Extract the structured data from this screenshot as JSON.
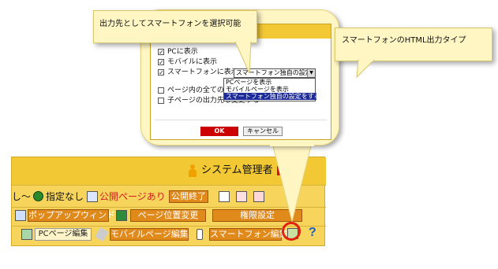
{
  "dialog": {
    "options": [
      {
        "label": "PCに表示",
        "checked": true
      },
      {
        "label": "モバイルに表示",
        "checked": true
      },
      {
        "label": "スマートフォンに表示",
        "checked": true
      },
      {
        "label": "ページ内の全てのエリ",
        "checked": false
      },
      {
        "label": "子ページの出力先も変更する",
        "checked": false
      }
    ],
    "select_value": "スマートフォン独自の設定をする",
    "select_options": [
      "PCページを表示",
      "モバイルページを表示",
      "スマートフォン独自の設定をする"
    ],
    "ok_label": "OK",
    "cancel_label": "キャンセル"
  },
  "callouts": {
    "left": "出力先としてスマートフォンを選択可能",
    "right": "スマートフォンのHTML出力タイプ"
  },
  "toolbar": {
    "admin_label": "システム管理者",
    "row1": {
      "prefix": "し～",
      "no_date": "指定なし",
      "published": "公開ページあり",
      "end_publish": "公開終了"
    },
    "row2": {
      "popup": "ポップアップウィンドウ",
      "page_move": "ページ位置変更",
      "permissions": "権限設定"
    },
    "row3": {
      "pc_edit": "PCページ編集",
      "mobile_edit": "モバイルページ編集",
      "smartphone_edit": "スマートフォン編集",
      "help": "?"
    }
  },
  "colors": {
    "toolbar_bg": "#f7d55c",
    "button_orange": "#e08a1c",
    "ok_red": "#cc0000",
    "highlight": "#e02010",
    "callout_bg": "#fff6c4"
  }
}
